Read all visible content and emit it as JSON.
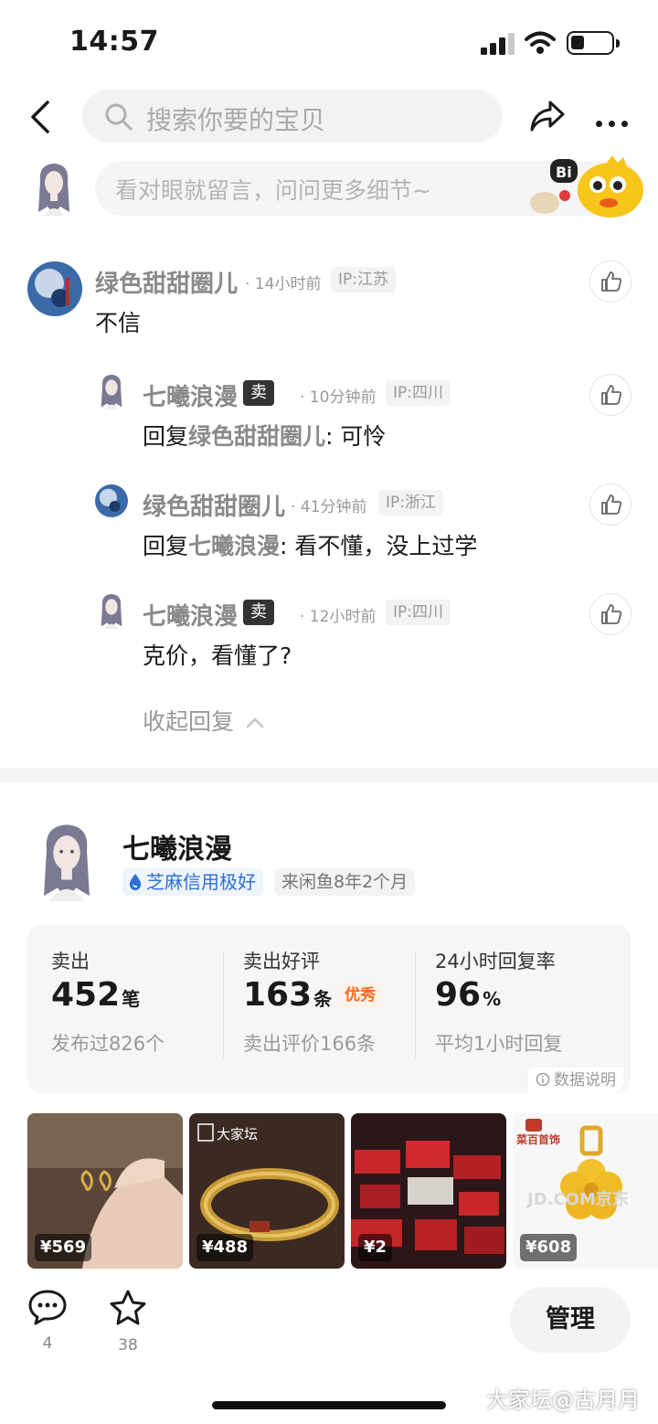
{
  "status": {
    "time": "14:57"
  },
  "search": {
    "placeholder": "搜索你要的宝贝"
  },
  "compose": {
    "placeholder": "看对眼就留言，问问更多细节~"
  },
  "comments": [
    {
      "name": "绿色甜甜圈儿",
      "seller_tag": "",
      "meta": "· 14小时前",
      "ip": "IP:江苏",
      "text": "不信",
      "reply_to": ""
    },
    {
      "name": "七曦浪漫",
      "seller_tag": "卖家",
      "meta": "· 10分钟前",
      "ip": "IP:四川",
      "prefix": "回复",
      "reply_to": "绿色甜甜圈儿",
      "text": ": 可怜"
    },
    {
      "name": "绿色甜甜圈儿",
      "seller_tag": "",
      "meta": "· 41分钟前",
      "ip": "IP:浙江",
      "prefix": "回复",
      "reply_to": "七曦浪漫",
      "text": ": 看不懂，没上过学"
    },
    {
      "name": "七曦浪漫",
      "seller_tag": "卖家",
      "meta": "· 12小时前",
      "ip": "IP:四川",
      "text": "克价，看懂了?"
    }
  ],
  "collapse_label": "收起回复",
  "seller": {
    "name": "七曦浪漫",
    "credit": "芝麻信用极好",
    "since": "来闲鱼8年2个月"
  },
  "stats": [
    {
      "label": "卖出",
      "value": "452",
      "unit": "笔",
      "badge": "",
      "sub": "发布过826个"
    },
    {
      "label": "卖出好评",
      "value": "163",
      "unit": "条",
      "badge": "优秀",
      "sub": "卖出评价166条"
    },
    {
      "label": "24小时回复率",
      "value": "96",
      "unit": "%",
      "badge": "",
      "sub": "平均1小时回复"
    }
  ],
  "data_note": "数据说明",
  "products": [
    {
      "price": "¥569",
      "overlay": ""
    },
    {
      "price": "¥488",
      "overlay": "大家坛"
    },
    {
      "price": "¥2",
      "overlay": ""
    },
    {
      "price": "¥608",
      "overlay": "菜百首饰"
    }
  ],
  "product_watermark": "JD.COM京东",
  "bottom": {
    "comment_count": "4",
    "fav_count": "38",
    "manage_label": "管理"
  },
  "watermark": "大家坛@古月月",
  "colors": {
    "accent_blue": "#2e6fd6",
    "badge_orange": "#f36b21",
    "seller_tag": "#333333"
  }
}
